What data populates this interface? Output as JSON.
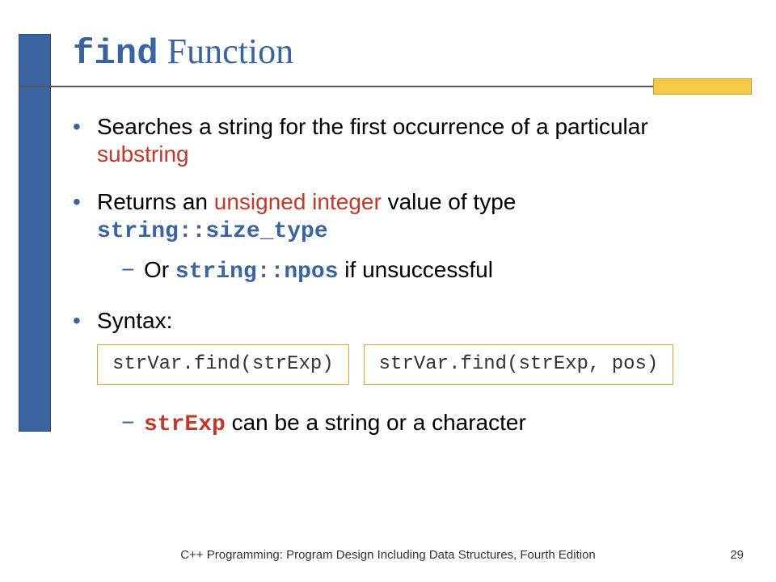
{
  "title": {
    "code": "find",
    "rest": " Function"
  },
  "bullets": {
    "b1_a": "Searches a string for the first occurrence of a particular ",
    "b1_red": "substring",
    "b2_a": "Returns an ",
    "b2_red": "unsigned integer",
    "b2_b": " value of type ",
    "b2_code": "string::size_type",
    "b2_sub_a": "Or ",
    "b2_sub_code": "string::npos",
    "b2_sub_b": " if unsuccessful",
    "b3": "Syntax:",
    "b3_sub_code": "strExp",
    "b3_sub_rest": " can be a string or a character"
  },
  "syntax": {
    "box1": "strVar.find(strExp)",
    "box2": "strVar.find(strExp, pos)"
  },
  "footer": {
    "text": "C++ Programming: Program Design Including Data Structures, Fourth Edition",
    "page": "29"
  }
}
